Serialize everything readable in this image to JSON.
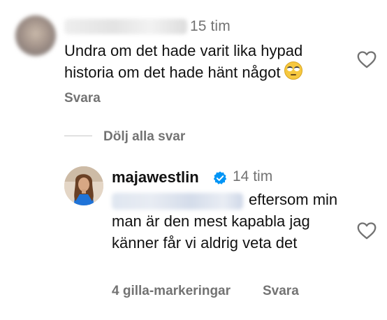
{
  "comments": [
    {
      "time": "15 tim",
      "text": "Undra om det hade varit lika hypad historia om det hade hänt något",
      "emoji": "face-with-rolling-eyes-emoji",
      "reply_label": "Svara",
      "like_icon": "heart-outline-icon"
    }
  ],
  "replies_toggle": {
    "label": "Dölj alla svar"
  },
  "reply": {
    "username": "majawestlin",
    "verified_icon": "verified-badge-icon",
    "verified_color": "#0095f6",
    "time": "14 tim",
    "text": "eftersom min man är den mest kapabla jag känner får vi aldrig veta det",
    "likes_label": "4 gilla-markeringar",
    "reply_label": "Svara",
    "like_icon": "heart-outline-icon"
  },
  "colors": {
    "primary_text": "#111111",
    "secondary_text": "#737373",
    "background": "#ffffff"
  }
}
